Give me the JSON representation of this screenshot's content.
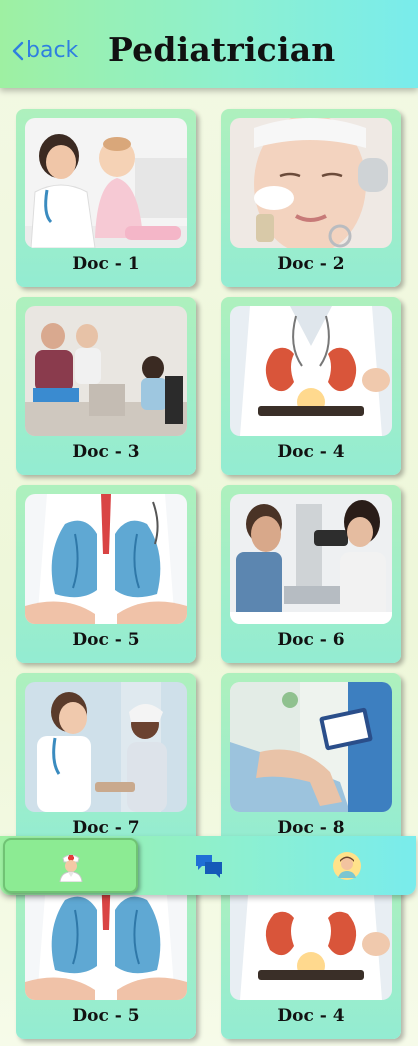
{
  "header": {
    "back_label": "back",
    "title": "Pediatrician"
  },
  "doctors": [
    {
      "label": "Doc - 1",
      "photo": "doctor-with-baby"
    },
    {
      "label": "Doc - 2",
      "photo": "facial-treatment"
    },
    {
      "label": "Doc - 3",
      "photo": "family-consultation"
    },
    {
      "label": "Doc - 4",
      "photo": "kidney-hologram"
    },
    {
      "label": "Doc - 5",
      "photo": "lungs-illustration"
    },
    {
      "label": "Doc - 6",
      "photo": "eye-examination"
    },
    {
      "label": "Doc - 7",
      "photo": "doctor-with-child"
    },
    {
      "label": "Doc - 8",
      "photo": "knee-examination"
    },
    {
      "label": "Doc - 5",
      "photo": "lungs-illustration"
    },
    {
      "label": "Doc - 4",
      "photo": "kidney-hologram"
    }
  ],
  "tabbar": {
    "tabs": [
      {
        "icon": "nurse-icon",
        "active": true
      },
      {
        "icon": "chat-icon",
        "active": false
      },
      {
        "icon": "patient-icon",
        "active": false
      }
    ]
  },
  "colors": {
    "accent_green": "#9ef0a2",
    "accent_teal": "#79ecec",
    "back_blue": "#2f7fe0"
  }
}
